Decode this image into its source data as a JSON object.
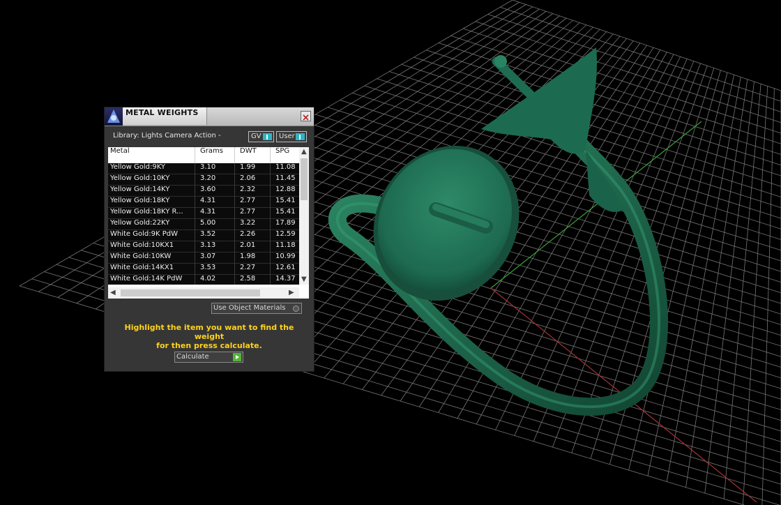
{
  "panel": {
    "title": "METAL WEIGHTS",
    "library_label": "Library: Lights Camera Action -",
    "gv_label": "GV",
    "user_label": "User",
    "columns": [
      "Metal",
      "Grams",
      "DWT",
      "SPG"
    ],
    "rows": [
      [
        "Yellow Gold:9KY",
        "3.10",
        "1.99",
        "11.08"
      ],
      [
        "Yellow Gold:10KY",
        "3.20",
        "2.06",
        "11.45"
      ],
      [
        "Yellow Gold:14KY",
        "3.60",
        "2.32",
        "12.88"
      ],
      [
        "Yellow Gold:18KY",
        "4.31",
        "2.77",
        "15.41"
      ],
      [
        "Yellow Gold:18KY R...",
        "4.31",
        "2.77",
        "15.41"
      ],
      [
        "Yellow Gold:22KY",
        "5.00",
        "3.22",
        "17.89"
      ],
      [
        "White Gold:9K PdW",
        "3.52",
        "2.26",
        "12.59"
      ],
      [
        "White Gold:10KX1",
        "3.13",
        "2.01",
        "11.18"
      ],
      [
        "White Gold:10KW",
        "3.07",
        "1.98",
        "10.99"
      ],
      [
        "White Gold:14KX1",
        "3.53",
        "2.27",
        "12.61"
      ],
      [
        "White Gold:14K PdW",
        "4.02",
        "2.58",
        "14.37"
      ]
    ],
    "use_object_materials_label": "Use Object Materials",
    "hint_line1": "Highlight the item you want to find the weight",
    "hint_line2": "for then press calculate.",
    "calculate_label": "Calculate"
  },
  "colors": {
    "model": "#1f6b52",
    "hint": "#ffd21a",
    "panel_bg": "#363636",
    "grid": "#9a9a9a",
    "x_axis": "#b23a3a",
    "y_axis": "#3aa83a"
  },
  "icons": {
    "title_logo": "app-logo-icon",
    "close": "close-icon",
    "toggle": "toggle-icon",
    "play": "play-icon"
  }
}
